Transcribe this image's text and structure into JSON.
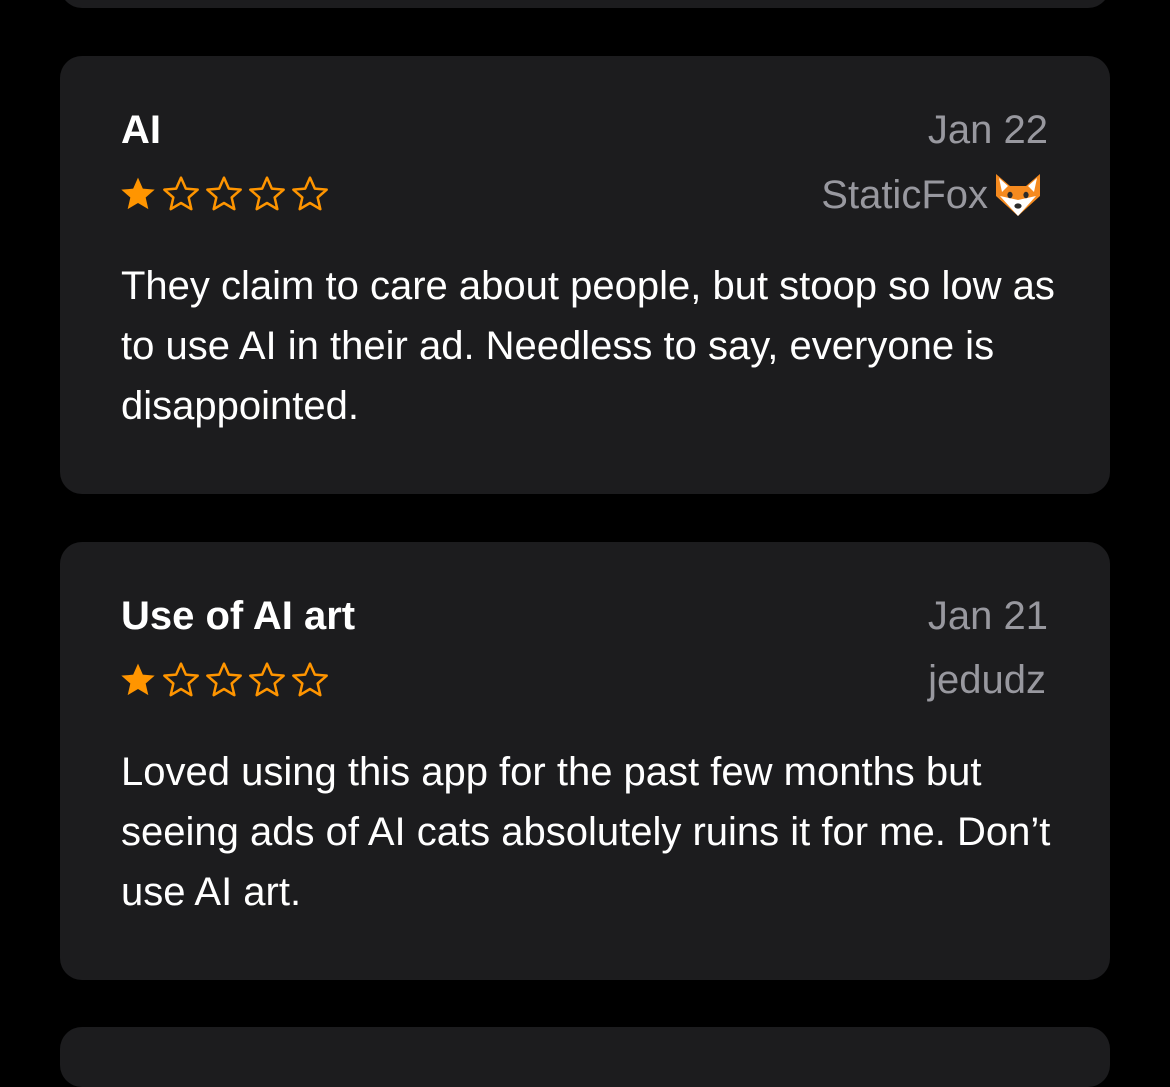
{
  "colors": {
    "background": "#000000",
    "card": "#1c1c1e",
    "secondary_text": "#98989f",
    "star": "#ff9500"
  },
  "reviews": [
    {
      "title": "AI",
      "date": "Jan 22",
      "author": "StaticFox",
      "author_emoji": "fox-face-icon",
      "rating": 1,
      "max_rating": 5,
      "body": "They claim to care about people, but stoop so low as to use AI in their ad. Needless to say, everyone is disappointed."
    },
    {
      "title": "Use of AI art",
      "date": "Jan 21",
      "author": "jedudz",
      "rating": 1,
      "max_rating": 5,
      "body": "Loved using this app for the past few months but seeing ads of AI cats absolutely ruins it for me. Don’t use AI art."
    }
  ]
}
